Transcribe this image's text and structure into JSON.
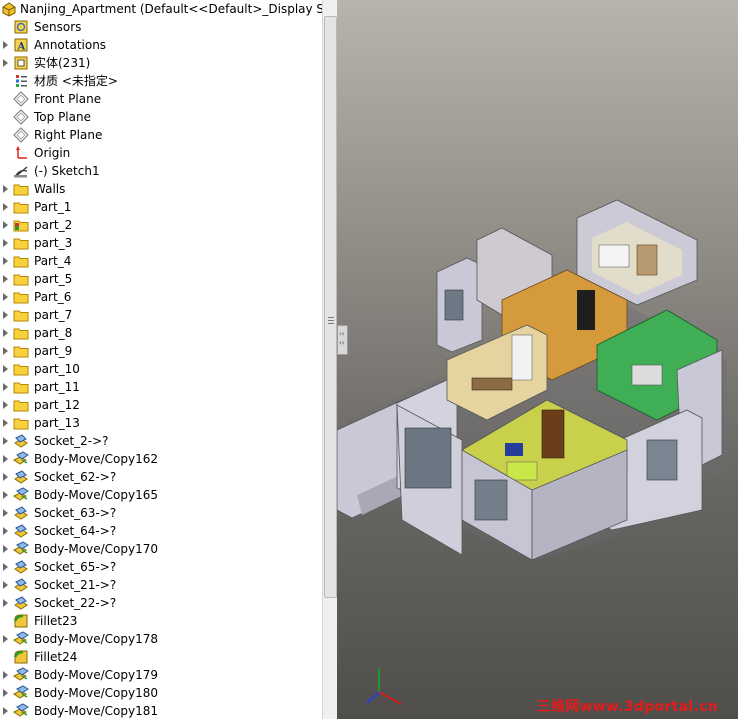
{
  "tree": {
    "root": "Nanjing_Apartment  (Default<<Default>_Display State",
    "items": [
      {
        "label": "Sensors",
        "icon": "sensors-icon",
        "expand": false
      },
      {
        "label": "Annotations",
        "icon": "annotations-icon",
        "expand": true
      },
      {
        "label": "实体(231)",
        "icon": "solid-bodies-icon",
        "expand": true
      },
      {
        "label": "材质 <未指定>",
        "icon": "material-icon",
        "expand": false
      },
      {
        "label": "Front Plane",
        "icon": "plane-icon",
        "expand": false
      },
      {
        "label": "Top Plane",
        "icon": "plane-icon",
        "expand": false
      },
      {
        "label": "Right Plane",
        "icon": "plane-icon",
        "expand": false
      },
      {
        "label": "Origin",
        "icon": "origin-icon",
        "expand": false
      },
      {
        "label": "(-) Sketch1",
        "icon": "sketch-icon",
        "expand": false
      },
      {
        "label": "Walls",
        "icon": "folder-icon",
        "expand": true
      },
      {
        "label": "Part_1",
        "icon": "folder-icon",
        "expand": true
      },
      {
        "label": "part_2",
        "icon": "feature-folder-icon",
        "expand": true
      },
      {
        "label": "part_3",
        "icon": "folder-icon",
        "expand": true
      },
      {
        "label": "Part_4",
        "icon": "folder-icon",
        "expand": true
      },
      {
        "label": "part_5",
        "icon": "folder-icon",
        "expand": true
      },
      {
        "label": "Part_6",
        "icon": "folder-icon",
        "expand": true
      },
      {
        "label": "part_7",
        "icon": "folder-icon",
        "expand": true
      },
      {
        "label": "part_8",
        "icon": "folder-icon",
        "expand": true
      },
      {
        "label": "part_9",
        "icon": "folder-icon",
        "expand": true
      },
      {
        "label": "part_10",
        "icon": "folder-icon",
        "expand": true
      },
      {
        "label": "part_11",
        "icon": "folder-icon",
        "expand": true
      },
      {
        "label": "part_12",
        "icon": "folder-icon",
        "expand": true
      },
      {
        "label": "part_13",
        "icon": "folder-icon",
        "expand": true
      },
      {
        "label": "Socket_2->?",
        "icon": "socket-icon",
        "expand": true
      },
      {
        "label": "Body-Move/Copy162",
        "icon": "move-copy-icon",
        "expand": true
      },
      {
        "label": "Socket_62->?",
        "icon": "socket-icon",
        "expand": true
      },
      {
        "label": "Body-Move/Copy165",
        "icon": "move-copy-icon",
        "expand": true
      },
      {
        "label": "Socket_63->?",
        "icon": "socket-icon",
        "expand": true
      },
      {
        "label": "Socket_64->?",
        "icon": "socket-icon",
        "expand": true
      },
      {
        "label": "Body-Move/Copy170",
        "icon": "move-copy-icon",
        "expand": true
      },
      {
        "label": "Socket_65->?",
        "icon": "socket-icon",
        "expand": true
      },
      {
        "label": "Socket_21->?",
        "icon": "socket-icon",
        "expand": true
      },
      {
        "label": "Socket_22->?",
        "icon": "socket-icon",
        "expand": true
      },
      {
        "label": "Fillet23",
        "icon": "fillet-icon",
        "expand": false
      },
      {
        "label": "Body-Move/Copy178",
        "icon": "move-copy-icon",
        "expand": true
      },
      {
        "label": "Fillet24",
        "icon": "fillet-icon",
        "expand": false
      },
      {
        "label": "Body-Move/Copy179",
        "icon": "move-copy-icon",
        "expand": true
      },
      {
        "label": "Body-Move/Copy180",
        "icon": "move-copy-icon",
        "expand": true
      },
      {
        "label": "Body-Move/Copy181",
        "icon": "move-copy-icon",
        "expand": true
      }
    ]
  },
  "viewport": {
    "watermark": "三维网www.3dportal.cn",
    "model": "apartment-3d-model"
  },
  "colors": {
    "folder": "#f7d23c",
    "watermark": "#e51b1b",
    "wall": "#c9c8d6",
    "floor": "#d59a3c",
    "green_room": "#3fae54",
    "yellow_room": "#c9d04c"
  }
}
